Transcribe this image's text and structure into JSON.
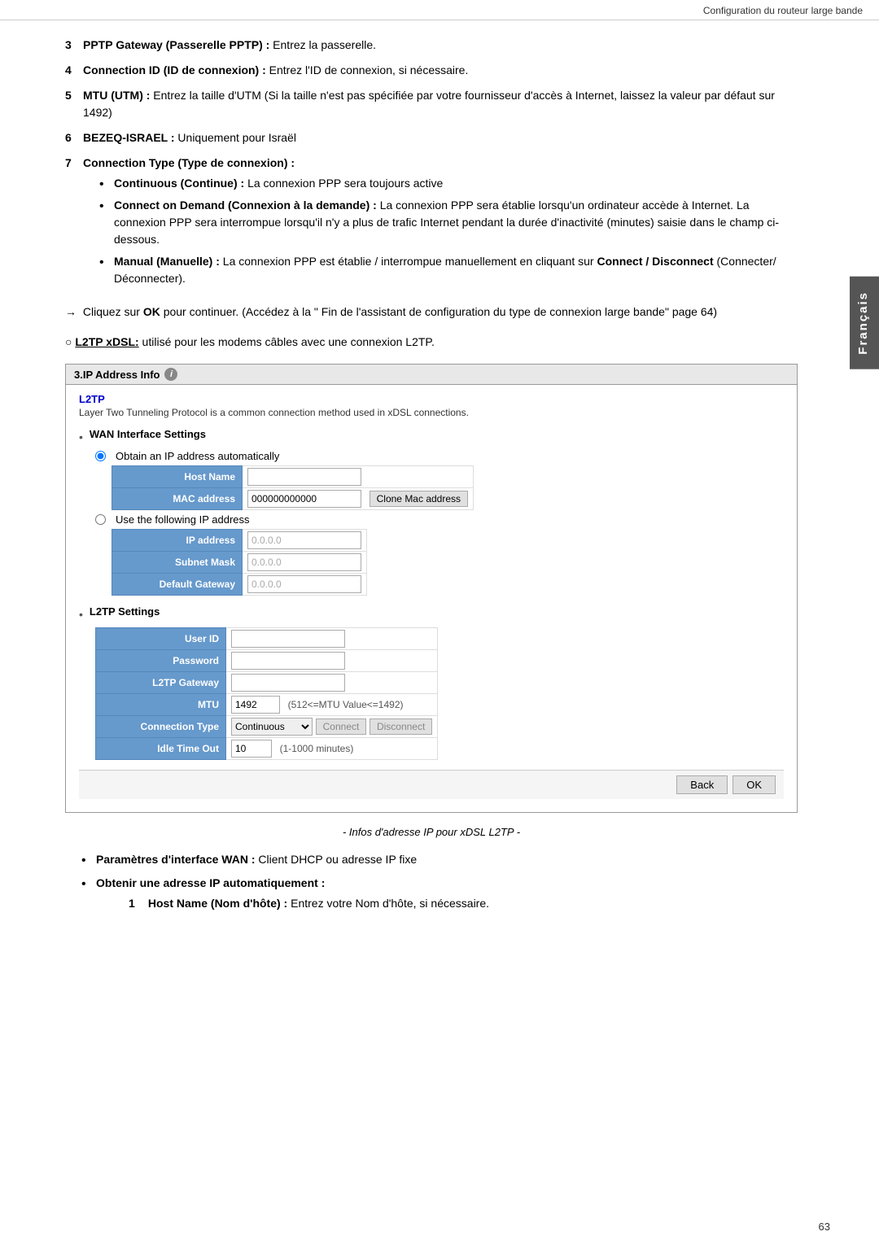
{
  "header": {
    "title": "Configuration du routeur large bande"
  },
  "side_tab": {
    "label": "Français"
  },
  "numbered_items": [
    {
      "num": "3",
      "bold_part": "PPTP Gateway (Passerelle PPTP) :",
      "rest": " Entrez la passerelle."
    },
    {
      "num": "4",
      "bold_part": "Connection ID (ID de connexion) :",
      "rest": " Entrez l'ID de connexion, si nécessaire."
    },
    {
      "num": "5",
      "bold_part": "MTU (UTM) :",
      "rest": " Entrez la taille d'UTM (Si la taille n'est pas spécifiée par votre fournisseur d'accès à Internet, laissez la valeur par défaut sur 1492)"
    },
    {
      "num": "6",
      "bold_part": "BEZEQ-ISRAEL :",
      "rest": " Uniquement pour Israël"
    },
    {
      "num": "7",
      "bold_part": "Connection Type (Type de connexion) :"
    }
  ],
  "bullets_7": [
    {
      "bold": "Continuous (Continue) :",
      "rest": " La connexion PPP sera toujours active"
    },
    {
      "bold": "Connect on Demand (Connexion à la demande) :",
      "rest": " La connexion PPP sera établie lorsqu'un ordinateur accède à Internet. La connexion PPP sera interrompue lorsqu'il n'y a plus de trafic Internet pendant la durée d'inactivité (minutes) saisie dans le champ ci-dessous."
    },
    {
      "bold": "Manual (Manuelle) :",
      "rest": " La connexion PPP est établie / interrompue manuellement en cliquant sur Connect / Disconnect (Connecter/ Déconnecter).",
      "bold2": "Connect / Disconnect"
    }
  ],
  "arrow_note": "Cliquez sur OK pour continuer. (Accédez à la \" Fin de l'assistant de configuration du type de connexion large bande\" page 64)",
  "arrow_bold": "OK",
  "l2tp_intro": "L2TP xDSL: utilisé pour les modems câbles avec une connexion L2TP.",
  "panel": {
    "header": "3.IP Address Info",
    "protocol": "L2TP",
    "protocol_desc": "Layer Two Tunneling Protocol is a common connection method used in xDSL connections.",
    "wan_settings_title": "WAN Interface Settings",
    "radio_auto": "Obtain an IP address automatically",
    "radio_manual": "Use the following IP address",
    "fields_auto": [
      {
        "label": "Host Name",
        "value": "",
        "placeholder": ""
      },
      {
        "label": "MAC address",
        "value": "000000000000",
        "placeholder": ""
      }
    ],
    "clone_btn": "Clone Mac address",
    "fields_manual": [
      {
        "label": "IP address",
        "value": "0.0.0.0",
        "placeholder": "0.0.0.0"
      },
      {
        "label": "Subnet Mask",
        "value": "0.0.0.0",
        "placeholder": "0.0.0.0"
      },
      {
        "label": "Default Gateway",
        "value": "0.0.0.0",
        "placeholder": "0.0.0.0"
      }
    ],
    "l2tp_settings_title": "L2TP Settings",
    "l2tp_fields": [
      {
        "label": "User ID",
        "value": ""
      },
      {
        "label": "Password",
        "value": ""
      },
      {
        "label": "L2TP Gateway",
        "value": ""
      },
      {
        "label": "MTU",
        "value": "1492",
        "hint": "(512<=MTU Value<=1492)"
      },
      {
        "label": "Connection Type",
        "value": "Continuous",
        "hint": ""
      },
      {
        "label": "Idle Time Out",
        "value": "10",
        "hint": "(1-1000 minutes)"
      }
    ],
    "connect_btn": "Connect",
    "disconnect_btn": "Disconnect",
    "back_btn": "Back",
    "ok_btn": "OK"
  },
  "caption": "- Infos d'adresse IP pour xDSL L2TP -",
  "bottom_section": {
    "bullet1_bold": "Paramètres d'interface WAN :",
    "bullet1_rest": " Client DHCP ou adresse IP fixe",
    "bullet2_bold": "Obtenir une adresse IP automatiquement :",
    "sub1_bold": "Host Name (Nom d'hôte) :",
    "sub1_rest": " Entrez votre Nom d'hôte, si nécessaire."
  },
  "page_number": "63"
}
